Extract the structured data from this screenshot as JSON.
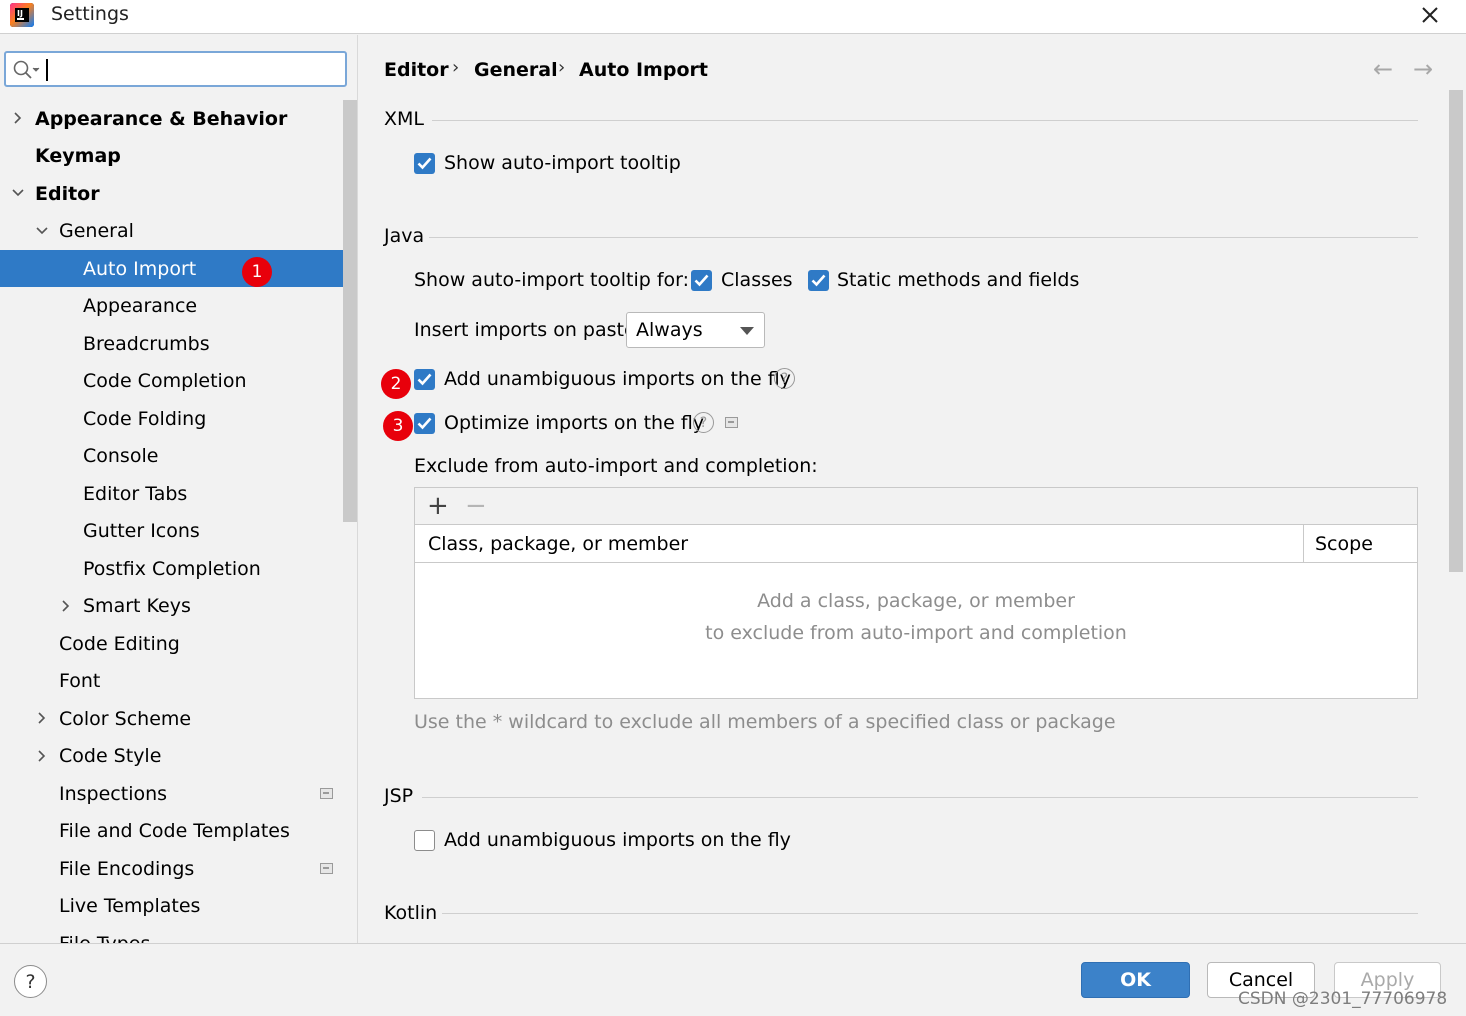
{
  "window": {
    "title": "Settings",
    "close_glyph": "✕"
  },
  "search": {
    "value": ""
  },
  "tree": [
    {
      "label": "Appearance & Behavior",
      "arrow": "right",
      "bold": true
    },
    {
      "label": "Keymap",
      "arrow": "none",
      "bold": true
    },
    {
      "label": "Editor",
      "arrow": "down",
      "bold": true
    },
    {
      "label": "General",
      "arrow": "down",
      "bold": false
    },
    {
      "label": "Auto Import",
      "arrow": "none",
      "bold": false,
      "selected": true,
      "badge": "1"
    },
    {
      "label": "Appearance",
      "arrow": "none"
    },
    {
      "label": "Breadcrumbs",
      "arrow": "none"
    },
    {
      "label": "Code Completion",
      "arrow": "none"
    },
    {
      "label": "Code Folding",
      "arrow": "none"
    },
    {
      "label": "Console",
      "arrow": "none"
    },
    {
      "label": "Editor Tabs",
      "arrow": "none"
    },
    {
      "label": "Gutter Icons",
      "arrow": "none"
    },
    {
      "label": "Postfix Completion",
      "arrow": "none"
    },
    {
      "label": "Smart Keys",
      "arrow": "right"
    },
    {
      "label": "Code Editing",
      "arrow": "none"
    },
    {
      "label": "Font",
      "arrow": "none"
    },
    {
      "label": "Color Scheme",
      "arrow": "right"
    },
    {
      "label": "Code Style",
      "arrow": "right"
    },
    {
      "label": "Inspections",
      "arrow": "none",
      "overlay_icon": true
    },
    {
      "label": "File and Code Templates",
      "arrow": "none"
    },
    {
      "label": "File Encodings",
      "arrow": "none",
      "overlay_icon": true
    },
    {
      "label": "Live Templates",
      "arrow": "none"
    },
    {
      "label": "File Types",
      "arrow": "none"
    }
  ],
  "breadcrumb": {
    "items": [
      "Editor",
      "General",
      "Auto Import"
    ],
    "separator": "›",
    "back": "←",
    "forward": "→"
  },
  "xml": {
    "title": "XML",
    "show_tooltip": {
      "label": "Show auto-import tooltip",
      "checked": true
    }
  },
  "java": {
    "title": "Java",
    "tooltip_for_label": "Show auto-import tooltip for:",
    "classes": {
      "label": "Classes",
      "checked": true
    },
    "static_methods": {
      "label": "Static methods and fields",
      "checked": true
    },
    "insert_label": "Insert imports on paste:",
    "insert_value": "Always",
    "add_unambiguous": {
      "label": "Add unambiguous imports on the fly",
      "checked": true,
      "badge": "2"
    },
    "optimize": {
      "label": "Optimize imports on the fly",
      "checked": true,
      "badge": "3"
    },
    "exclude_label": "Exclude from auto-import and completion:",
    "toolbar": {
      "add": "+",
      "remove": "−"
    },
    "columns": [
      "Class, package, or member",
      "Scope"
    ],
    "empty_line1": "Add a class, package, or member",
    "empty_line2": "to exclude from auto-import and completion",
    "hint": "Use the * wildcard to exclude all members of a specified class or package"
  },
  "jsp": {
    "title": "JSP",
    "add_unambiguous": {
      "label": "Add unambiguous imports on the fly",
      "checked": false
    }
  },
  "kotlin": {
    "title": "Kotlin"
  },
  "buttons": {
    "help": "?",
    "ok": "OK",
    "cancel": "Cancel",
    "apply": "Apply"
  },
  "watermark": "CSDN @2301_77706978",
  "colors": {
    "accent": "#2f7ac6",
    "badge": "#e8000b",
    "ok_button": "#3c82c9"
  }
}
